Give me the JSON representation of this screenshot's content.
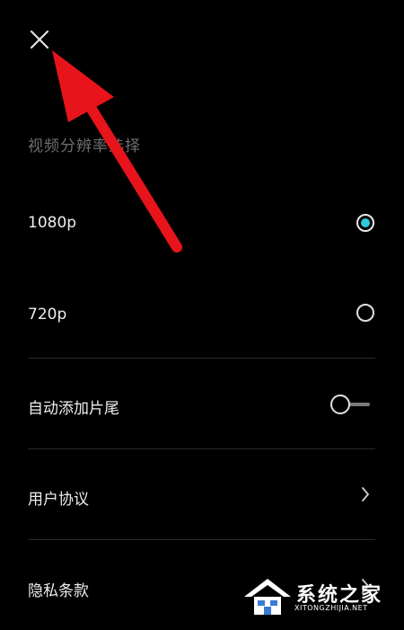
{
  "header": {
    "close_icon": "close-icon"
  },
  "resolution": {
    "section_title": "视频分辨率选择",
    "options": [
      {
        "label": "1080p",
        "selected": true
      },
      {
        "label": "720p",
        "selected": false
      }
    ],
    "accent_color": "#2ec8dc"
  },
  "settings": {
    "auto_outro_label": "自动添加片尾",
    "auto_outro_enabled": false,
    "user_agreement_label": "用户协议",
    "privacy_policy_label": "隐私条款"
  },
  "annotation": {
    "arrow_color": "#e8141b"
  },
  "watermark": {
    "title": "系统之家",
    "subtitle": "XITONGZHIJIA.NET"
  }
}
